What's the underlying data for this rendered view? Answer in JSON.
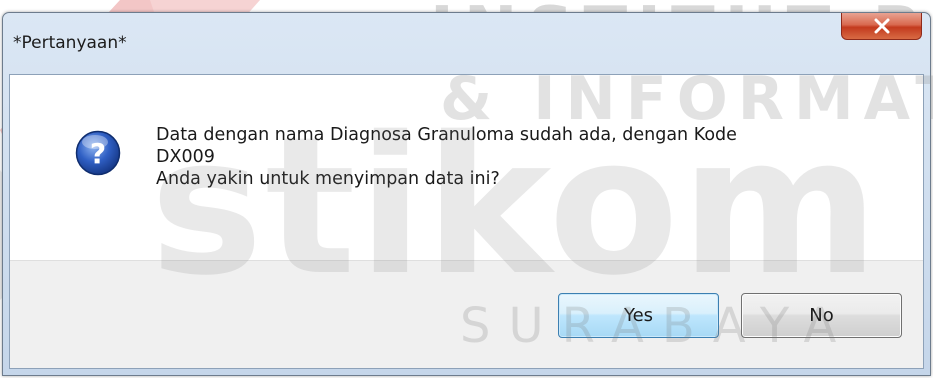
{
  "window": {
    "title": "*Pertanyaan*"
  },
  "icons": {
    "dialog_icon": "question-icon",
    "close_icon": "close-icon"
  },
  "message": {
    "line1": "Data dengan nama Diagnosa Granuloma sudah ada, dengan Kode",
    "line2": "DX009",
    "line3": "Anda yakin untuk menyimpan data ini?"
  },
  "buttons": {
    "yes_label": "Yes",
    "no_label": "No"
  },
  "watermark": {
    "line1": "INSTITUT BISNIS",
    "line2": "& INFORMATIKA",
    "brand": "stikom",
    "city": "SURABAYA"
  },
  "colors": {
    "titlebar": "#c5d6ea",
    "close_button": "#c33a1e",
    "default_button_border": "#3c7fb1",
    "button_bar": "#f0f0f0"
  }
}
